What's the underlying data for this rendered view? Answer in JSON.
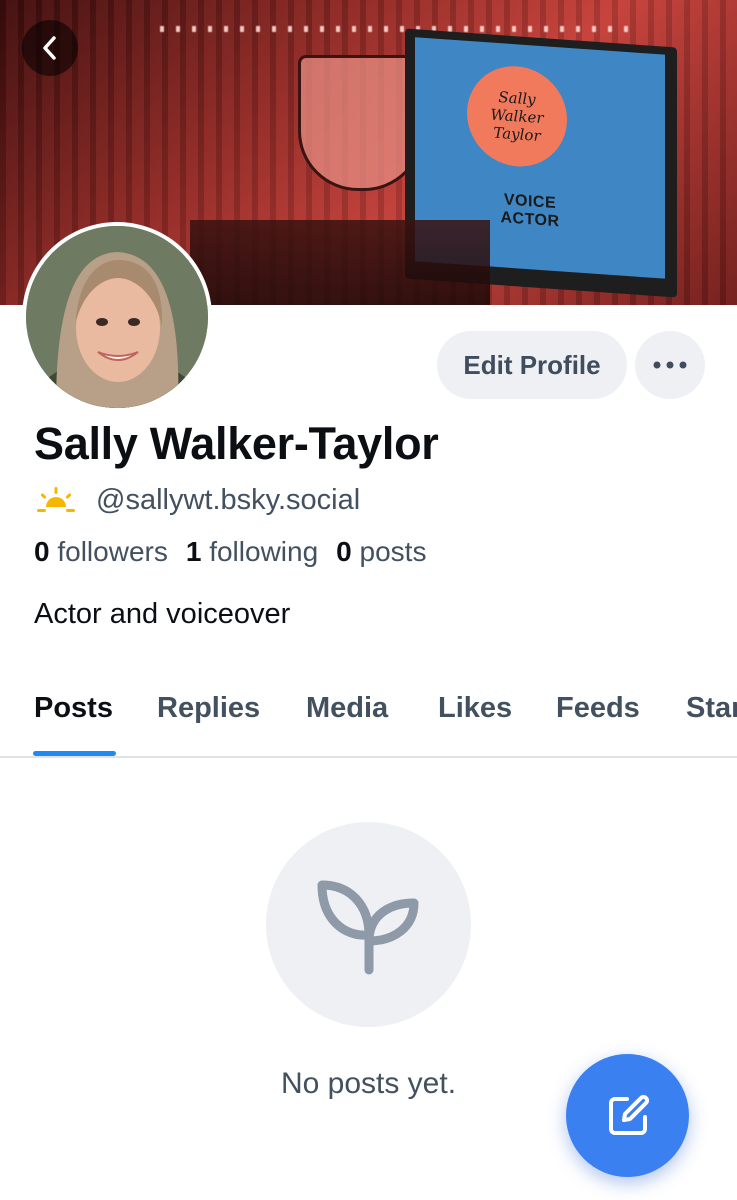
{
  "banner": {
    "logo_text": [
      "Sally",
      "Walker",
      "Taylor"
    ],
    "voice_actor_text": "VOICE ACTOR"
  },
  "actions": {
    "edit_profile_label": "Edit Profile"
  },
  "profile": {
    "display_name": "Sally Walker-Taylor",
    "handle": "@sallywt.bsky.social",
    "bio": "Actor and voiceover"
  },
  "stats": {
    "followers_count": "0",
    "followers_label": "followers",
    "following_count": "1",
    "following_label": "following",
    "posts_count": "0",
    "posts_label": "posts"
  },
  "tabs": [
    {
      "label": "Posts",
      "active": true
    },
    {
      "label": "Replies",
      "active": false
    },
    {
      "label": "Media",
      "active": false
    },
    {
      "label": "Likes",
      "active": false
    },
    {
      "label": "Feeds",
      "active": false
    },
    {
      "label": "Starter Packs",
      "active": false
    }
  ],
  "empty_state": {
    "message": "No posts yet.",
    "icon": "sprout-icon"
  },
  "icons": {
    "back": "chevron-left-icon",
    "more": "ellipsis-icon",
    "handle_badge": "sunrise-icon",
    "compose": "compose-icon"
  },
  "colors": {
    "accent": "#1d8bf3",
    "fab": "#3a80f0",
    "muted_text": "#42505f",
    "button_bg": "#eef0f3",
    "sun": "#f5b800"
  }
}
